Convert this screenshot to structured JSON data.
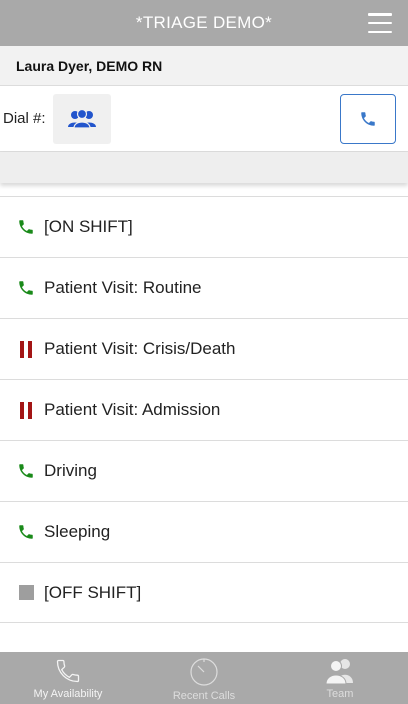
{
  "header": {
    "title": "*TRIAGE DEMO*"
  },
  "user": {
    "name": "Laura Dyer, DEMO RN"
  },
  "dial": {
    "label": "Dial #:"
  },
  "statuses": [
    {
      "label": "[ON SHIFT]",
      "icon": "phone-icon",
      "color": "#1a8a1a"
    },
    {
      "label": "Patient Visit: Routine",
      "icon": "phone-icon",
      "color": "#1a8a1a"
    },
    {
      "label": "Patient Visit: Crisis/Death",
      "icon": "pause-icon",
      "color": "#a31515"
    },
    {
      "label": "Patient Visit: Admission",
      "icon": "pause-icon",
      "color": "#a31515"
    },
    {
      "label": "Driving",
      "icon": "phone-icon",
      "color": "#1a8a1a"
    },
    {
      "label": "Sleeping",
      "icon": "phone-icon",
      "color": "#1a8a1a"
    },
    {
      "label": "[OFF SHIFT]",
      "icon": "stop-icon",
      "color": "#9e9e9e"
    }
  ],
  "tabs": [
    {
      "label": "My Availability",
      "icon": "phone-outline-icon"
    },
    {
      "label": "Recent Calls",
      "icon": "timer-icon"
    },
    {
      "label": "Team",
      "icon": "team-icon"
    }
  ],
  "colors": {
    "header_bg": "#a9a9a9",
    "accent_blue": "#3a78c9",
    "team_icon_blue": "#2255cc"
  }
}
